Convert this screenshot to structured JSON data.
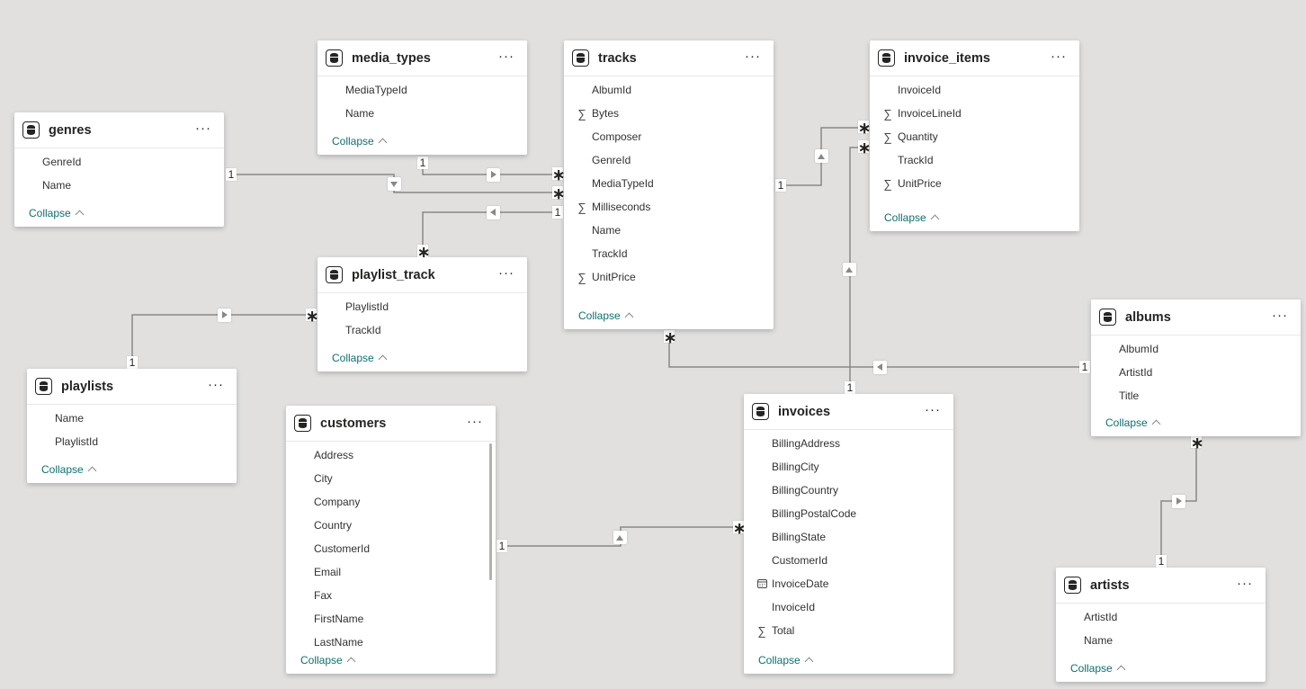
{
  "tables": {
    "genres": {
      "name": "genres",
      "fields": [
        {
          "name": "GenreId",
          "type": ""
        },
        {
          "name": "Name",
          "type": ""
        }
      ],
      "collapse": "Collapse"
    },
    "media_types": {
      "name": "media_types",
      "fields": [
        {
          "name": "MediaTypeId",
          "type": ""
        },
        {
          "name": "Name",
          "type": ""
        }
      ],
      "collapse": "Collapse"
    },
    "tracks": {
      "name": "tracks",
      "fields": [
        {
          "name": "AlbumId",
          "type": ""
        },
        {
          "name": "Bytes",
          "type": "sum"
        },
        {
          "name": "Composer",
          "type": ""
        },
        {
          "name": "GenreId",
          "type": ""
        },
        {
          "name": "MediaTypeId",
          "type": ""
        },
        {
          "name": "Milliseconds",
          "type": "sum"
        },
        {
          "name": "Name",
          "type": ""
        },
        {
          "name": "TrackId",
          "type": ""
        },
        {
          "name": "UnitPrice",
          "type": "sum"
        }
      ],
      "collapse": "Collapse"
    },
    "invoice_items": {
      "name": "invoice_items",
      "fields": [
        {
          "name": "InvoiceId",
          "type": ""
        },
        {
          "name": "InvoiceLineId",
          "type": "sum"
        },
        {
          "name": "Quantity",
          "type": "sum"
        },
        {
          "name": "TrackId",
          "type": ""
        },
        {
          "name": "UnitPrice",
          "type": "sum"
        }
      ],
      "collapse": "Collapse"
    },
    "playlist_track": {
      "name": "playlist_track",
      "fields": [
        {
          "name": "PlaylistId",
          "type": ""
        },
        {
          "name": "TrackId",
          "type": ""
        }
      ],
      "collapse": "Collapse"
    },
    "playlists": {
      "name": "playlists",
      "fields": [
        {
          "name": "Name",
          "type": ""
        },
        {
          "name": "PlaylistId",
          "type": ""
        }
      ],
      "collapse": "Collapse"
    },
    "customers": {
      "name": "customers",
      "fields": [
        {
          "name": "Address",
          "type": ""
        },
        {
          "name": "City",
          "type": ""
        },
        {
          "name": "Company",
          "type": ""
        },
        {
          "name": "Country",
          "type": ""
        },
        {
          "name": "CustomerId",
          "type": ""
        },
        {
          "name": "Email",
          "type": ""
        },
        {
          "name": "Fax",
          "type": ""
        },
        {
          "name": "FirstName",
          "type": ""
        },
        {
          "name": "LastName",
          "type": ""
        }
      ],
      "collapse": "Collapse"
    },
    "invoices": {
      "name": "invoices",
      "fields": [
        {
          "name": "BillingAddress",
          "type": ""
        },
        {
          "name": "BillingCity",
          "type": ""
        },
        {
          "name": "BillingCountry",
          "type": ""
        },
        {
          "name": "BillingPostalCode",
          "type": ""
        },
        {
          "name": "BillingState",
          "type": ""
        },
        {
          "name": "CustomerId",
          "type": ""
        },
        {
          "name": "InvoiceDate",
          "type": "date"
        },
        {
          "name": "InvoiceId",
          "type": ""
        },
        {
          "name": "Total",
          "type": "sum"
        }
      ],
      "collapse": "Collapse"
    },
    "albums": {
      "name": "albums",
      "fields": [
        {
          "name": "AlbumId",
          "type": ""
        },
        {
          "name": "ArtistId",
          "type": ""
        },
        {
          "name": "Title",
          "type": ""
        }
      ],
      "collapse": "Collapse"
    },
    "artists": {
      "name": "artists",
      "fields": [
        {
          "name": "ArtistId",
          "type": ""
        },
        {
          "name": "Name",
          "type": ""
        }
      ],
      "collapse": "Collapse"
    }
  },
  "icons": {
    "table": "table-icon",
    "more": "more-options-icon",
    "sum": "sigma-icon",
    "date": "calendar-icon",
    "collapse": "chevron-up-icon"
  },
  "more_glyph": "···",
  "cardinality": {
    "one": "1",
    "many": "∗"
  },
  "relationships": [
    {
      "from": "genres",
      "to": "tracks",
      "from_card": "1",
      "to_card": "*",
      "direction": "down"
    },
    {
      "from": "media_types",
      "to": "tracks",
      "from_card": "1",
      "to_card": "*",
      "direction": "right"
    },
    {
      "from": "tracks",
      "to": "playlist_track",
      "from_card": "1",
      "to_card": "*",
      "direction": "left"
    },
    {
      "from": "tracks",
      "to": "invoice_items",
      "from_card": "1",
      "to_card": "*",
      "direction": "up"
    },
    {
      "from": "invoices",
      "to": "invoice_items",
      "from_card": "1",
      "to_card": "*",
      "direction": "up"
    },
    {
      "from": "albums",
      "to": "tracks",
      "from_card": "1",
      "to_card": "*",
      "direction": "left"
    },
    {
      "from": "playlists",
      "to": "playlist_track",
      "from_card": "1",
      "to_card": "*",
      "direction": "right"
    },
    {
      "from": "customers",
      "to": "invoices",
      "from_card": "1",
      "to_card": "*",
      "direction": "up"
    },
    {
      "from": "artists",
      "to": "albums",
      "from_card": "1",
      "to_card": "*",
      "direction": "right"
    }
  ]
}
